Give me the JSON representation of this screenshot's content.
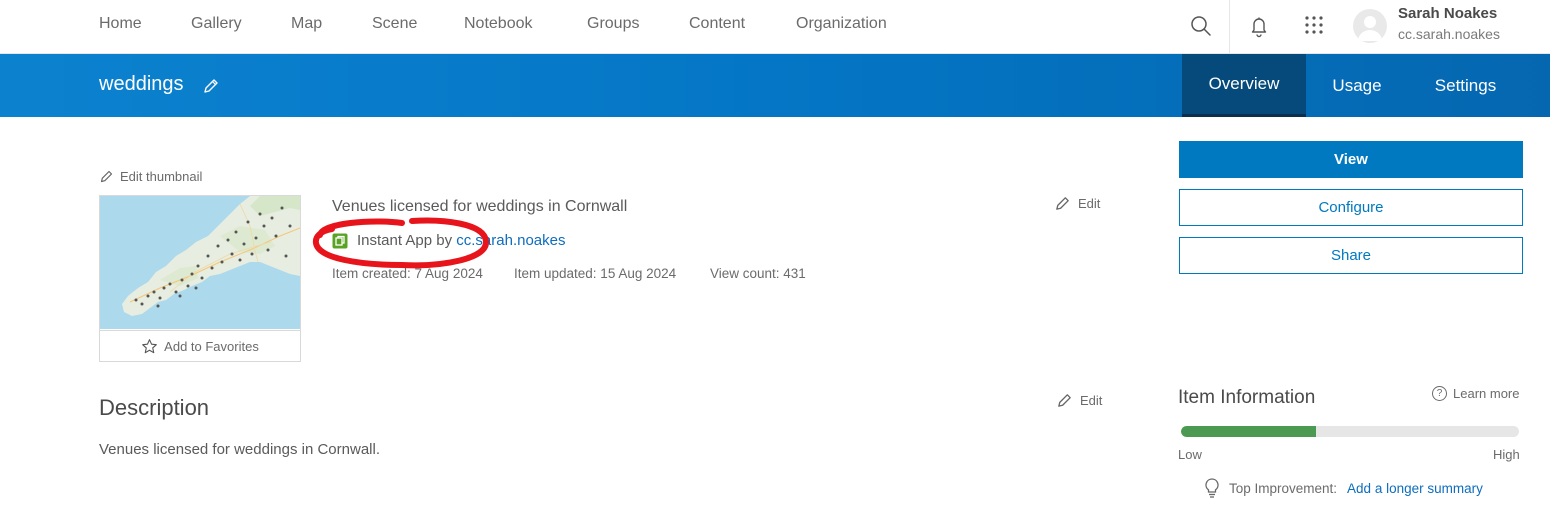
{
  "nav": {
    "items": [
      "Home",
      "Gallery",
      "Map",
      "Scene",
      "Notebook",
      "Groups",
      "Content",
      "Organization"
    ],
    "icons": [
      "search-icon",
      "bell-icon",
      "app-launcher-icon"
    ],
    "user": {
      "name": "Sarah Noakes",
      "handle": "cc.sarah.noakes"
    }
  },
  "header": {
    "title": "weddings",
    "tabs": [
      "Overview",
      "Usage",
      "Settings"
    ],
    "active_tab": "Overview",
    "colors": {
      "bar": "#0476c5",
      "active_tab": "#054a7a"
    }
  },
  "thumbnail": {
    "edit_label": "Edit thumbnail",
    "favorite_label": "Add to Favorites"
  },
  "item": {
    "summary": "Venues licensed for weddings in Cornwall",
    "type_prefix": "Instant App by ",
    "owner": "cc.sarah.noakes",
    "created": "Item created: 7 Aug 2024",
    "updated": "Item updated: 15 Aug 2024",
    "views": "View count: 431",
    "edit_label": "Edit"
  },
  "description": {
    "heading": "Description",
    "text": "Venues licensed for weddings in Cornwall.",
    "edit_label": "Edit"
  },
  "actions": {
    "view": "View",
    "configure": "Configure",
    "share": "Share",
    "accent": "#0079c1"
  },
  "item_info": {
    "heading": "Item Information",
    "learn_more": "Learn more",
    "score_fraction": 0.4,
    "low_label": "Low",
    "high_label": "High",
    "improvement_label": "Top Improvement:",
    "improvement_link": "Add a longer summary",
    "meter_color": "#4c9a52"
  },
  "annotation": {
    "color": "#e8141b"
  }
}
